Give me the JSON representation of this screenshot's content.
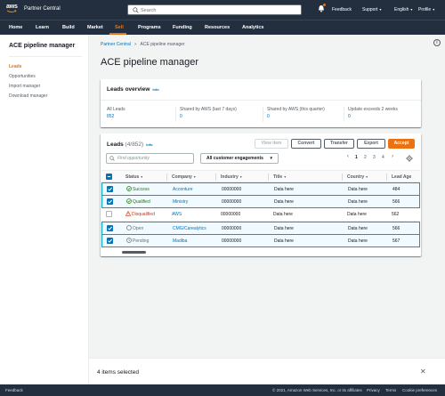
{
  "colors": {
    "brand_dark": "#232f3e",
    "accent": "#ec7211",
    "link": "#0073bb",
    "success": "#1d8102",
    "error": "#d13212",
    "neutral": "#687078",
    "selected_bg": "#f1faff",
    "selected_border": "#00a1c9"
  },
  "topbar": {
    "logo_text": "aws",
    "brand": "Partner Central",
    "search_placeholder": "Search",
    "notifications_icon": "bell-icon",
    "links": [
      "Feedback",
      "Support",
      "English",
      "Profile"
    ]
  },
  "nav": {
    "items": [
      "Home",
      "Learn",
      "Build",
      "Market",
      "Sell",
      "Programs",
      "Funding",
      "Resources",
      "Analytics"
    ],
    "active": "Sell"
  },
  "sidebar": {
    "title": "ACE pipeline manager",
    "links": [
      "Leads",
      "Opportunities",
      "Import manager",
      "Download manager"
    ],
    "active": "Leads"
  },
  "rail": {
    "info_icon": "info-icon",
    "glyph": "i"
  },
  "breadcrumb": {
    "items": [
      "Partner Central",
      "ACE pipeline manager"
    ],
    "separator": ">"
  },
  "page_title": "ACE pipeline manager",
  "overview": {
    "title": "Leads overview",
    "info": "Info",
    "stats": [
      {
        "label": "All Leads",
        "value": "852"
      },
      {
        "label": "Shared by AWS (last 7 days)",
        "value": "0"
      },
      {
        "label": "Shared by AWS (this quarter)",
        "value": "0"
      },
      {
        "label": "Update exceeds 2 weeks",
        "value": "0"
      }
    ]
  },
  "leads": {
    "title": "Leads",
    "count": "(4/852)",
    "info": "Info",
    "buttons": {
      "view": "View item",
      "convert": "Convert",
      "transfer": "Transfer",
      "export": "Export",
      "accept": "Accept"
    },
    "filter_placeholder": "Find opportunity",
    "engagement_select": "All customer engagements",
    "pagination": {
      "prev": "‹",
      "pages": [
        "1",
        "2",
        "3",
        "4"
      ],
      "current": "1",
      "next": "›"
    },
    "columns": [
      "Status",
      "Company",
      "Industry",
      "Title",
      "Country",
      "Lead Age"
    ],
    "rows": [
      {
        "selected": true,
        "status": "Success",
        "status_type": "success",
        "company": "Accenture",
        "industry": "00000000",
        "title": "Data here",
        "country": "Data here",
        "age": "484"
      },
      {
        "selected": true,
        "status": "Qualified",
        "status_type": "success",
        "company": "Ministry",
        "industry": "00000000",
        "title": "Data here",
        "country": "Data here",
        "age": "566"
      },
      {
        "selected": false,
        "status": "Disqualified",
        "status_type": "error",
        "company": "AWS",
        "industry": "00000000",
        "title": "Data here",
        "country": "Data here",
        "age": "562"
      },
      {
        "selected": true,
        "status": "Open",
        "status_type": "neutral",
        "company": "CMG/Carealytics",
        "industry": "00000000",
        "title": "Data here",
        "country": "Data here",
        "age": "566"
      },
      {
        "selected": true,
        "status": "Pending",
        "status_type": "neutral",
        "company": "Madiba",
        "industry": "00000000",
        "title": "Data here",
        "country": "Data here",
        "age": "567"
      }
    ]
  },
  "selection_bar": {
    "text": "4 items selected",
    "close": "✕"
  },
  "footer": {
    "feedback": "Feedback",
    "copyright": "© 2021, Amazon Web Services, Inc. or its affiliates",
    "links": [
      "Privacy",
      "Terms",
      "Cookie preferences"
    ]
  }
}
